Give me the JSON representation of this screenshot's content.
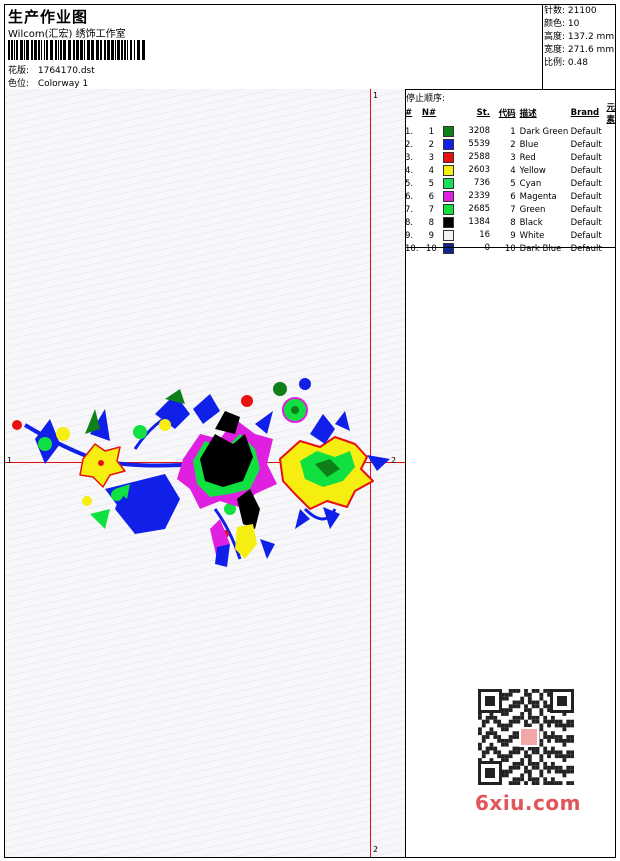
{
  "header": {
    "title": "生产作业图",
    "company": "Wilcom(汇宏) 绣饰工作室",
    "pattern_label": "花版:",
    "pattern_value": "1764170.dst",
    "colorway_label": "色位:",
    "colorway_value": "Colorway 1"
  },
  "stats": {
    "stitches_label": "针数:",
    "stitches_value": "21100",
    "colors_label": "颜色:",
    "colors_value": "10",
    "height_label": "高度:",
    "height_value": "137.2 mm",
    "width_label": "宽度:",
    "width_value": "271.6 mm",
    "scale_label": "比例:",
    "scale_value": "0.48"
  },
  "canvas": {
    "marks": {
      "top": "1",
      "left": "1",
      "right": "2",
      "bottom": "2"
    }
  },
  "stop_sequence": {
    "title": "停止顺序:",
    "headers": {
      "index": "#",
      "no": "N#",
      "st": "St.",
      "code": "代码",
      "desc": "描述",
      "brand": "Brand",
      "element": "元素"
    },
    "rows": [
      {
        "index": "1.",
        "no": "1",
        "color": "#0f7f1a",
        "st": "3208",
        "code": "1",
        "desc": "Dark Green",
        "brand": "Default"
      },
      {
        "index": "2.",
        "no": "2",
        "color": "#1020e8",
        "st": "5539",
        "code": "2",
        "desc": "Blue",
        "brand": "Default"
      },
      {
        "index": "3.",
        "no": "3",
        "color": "#e81010",
        "st": "2588",
        "code": "3",
        "desc": "Red",
        "brand": "Default"
      },
      {
        "index": "4.",
        "no": "4",
        "color": "#f6ee10",
        "st": "2603",
        "code": "4",
        "desc": "Yellow",
        "brand": "Default"
      },
      {
        "index": "5.",
        "no": "5",
        "color": "#18e05a",
        "st": "736",
        "code": "5",
        "desc": "Cyan",
        "brand": "Default"
      },
      {
        "index": "6.",
        "no": "6",
        "color": "#e020e0",
        "st": "2339",
        "code": "6",
        "desc": "Magenta",
        "brand": "Default"
      },
      {
        "index": "7.",
        "no": "7",
        "color": "#10e040",
        "st": "2685",
        "code": "7",
        "desc": "Green",
        "brand": "Default"
      },
      {
        "index": "8.",
        "no": "8",
        "color": "#000000",
        "st": "1384",
        "code": "8",
        "desc": "Black",
        "brand": "Default"
      },
      {
        "index": "9.",
        "no": "9",
        "color": "#f2f2f2",
        "st": "16",
        "code": "9",
        "desc": "White",
        "brand": "Default"
      },
      {
        "index": "10.",
        "no": "10",
        "color": "#12248c",
        "st": "0",
        "code": "10",
        "desc": "Dark Blue",
        "brand": "Default"
      }
    ]
  },
  "watermark": {
    "logo_text": "6xiu.com",
    "color": "#e2555b"
  }
}
